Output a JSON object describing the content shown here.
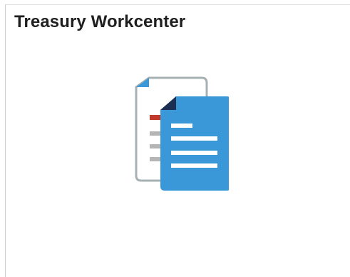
{
  "tile": {
    "title": "Treasury Workcenter",
    "icon": "documents-icon"
  },
  "colors": {
    "title_text": "#1f1f1f",
    "doc_front_blue": "#3a97d8",
    "doc_front_fold": "#1c2f52",
    "doc_back_accent": "#c23a2c",
    "doc_back_outline": "#9aa6a9"
  }
}
